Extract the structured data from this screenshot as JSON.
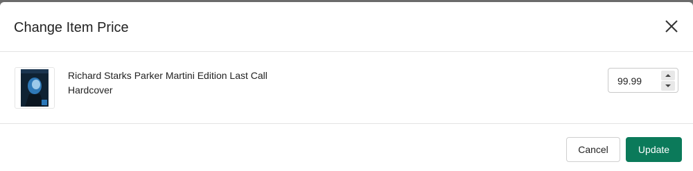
{
  "dialog": {
    "title": "Change Item Price",
    "close_icon": "close-icon"
  },
  "item": {
    "title": "Richard Starks Parker Martini Edition Last Call",
    "format": "Hardcover",
    "thumbnail_icon": "book-cover-image",
    "price": "99.99"
  },
  "actions": {
    "cancel_label": "Cancel",
    "update_label": "Update",
    "update_color": "#0b7a5a"
  }
}
